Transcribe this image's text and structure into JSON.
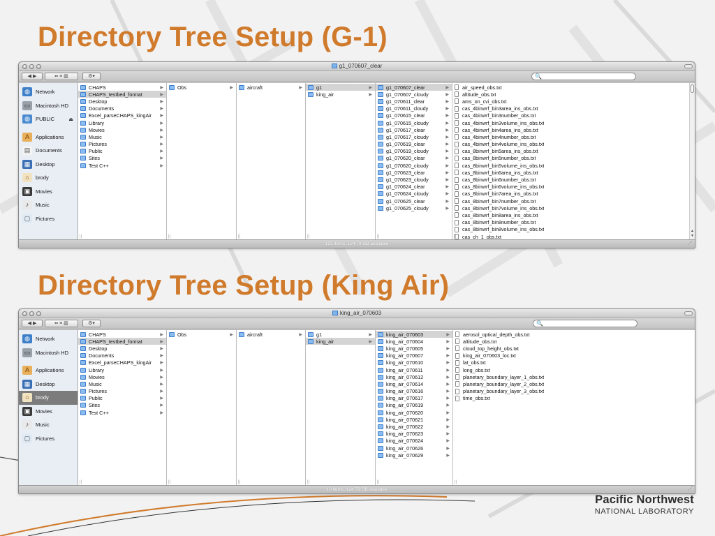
{
  "slide": {
    "title_g1": "Directory Tree Setup (G-1)",
    "title_kingair": "Directory Tree Setup (King Air)",
    "logo_main": "Pacific Northwest",
    "logo_sub": "NATIONAL LABORATORY",
    "accent_color": "#d07a2c"
  },
  "window_g1": {
    "title": "g1_070607_clear",
    "status": "122 items, 124.79 GB available",
    "sidebar": [
      {
        "label": "Network",
        "icon": "globe-icon"
      },
      {
        "label": "Macintosh HD",
        "icon": "hard-drive-icon"
      },
      {
        "label": "PUBLIC",
        "icon": "network-volume-icon",
        "eject": true
      },
      {
        "label": "Applications",
        "icon": "applications-icon"
      },
      {
        "label": "Documents",
        "icon": "documents-icon"
      },
      {
        "label": "Desktop",
        "icon": "desktop-icon"
      },
      {
        "label": "brody",
        "icon": "home-icon"
      },
      {
        "label": "Movies",
        "icon": "movies-icon"
      },
      {
        "label": "Music",
        "icon": "music-icon"
      },
      {
        "label": "Pictures",
        "icon": "pictures-icon"
      }
    ],
    "col1": [
      "CHAPS",
      "CHAPS_testbed_format",
      "Desktop",
      "Documents",
      "Excel_parseCHAPS_kingAir",
      "Library",
      "Movies",
      "Music",
      "Pictures",
      "Public",
      "Sites",
      "Test C++"
    ],
    "col1_selected": 1,
    "col2": [
      "Obs"
    ],
    "col3": [
      "aircraft"
    ],
    "col4": [
      "g1",
      "king_air"
    ],
    "col4_selected": 0,
    "col5": [
      "g1_070607_clear",
      "g1_070607_cloudy",
      "g1_070611_clear",
      "g1_070611_cloudy",
      "g1_070615_clear",
      "g1_070615_cloudy",
      "g1_070617_clear",
      "g1_070617_cloudy",
      "g1_070619_clear",
      "g1_070619_cloudy",
      "g1_070620_clear",
      "g1_070620_cloudy",
      "g1_070623_clear",
      "g1_070623_cloudy",
      "g1_070624_clear",
      "g1_070624_cloudy",
      "g1_070625_clear",
      "g1_070625_cloudy"
    ],
    "col5_selected": 0,
    "files": [
      "air_speed_obs.txt",
      "altitude_obs.txt",
      "ams_on_cvi_obs.txt",
      "cas_4binwrf_bin3area_ins_obs.txt",
      "cas_4binwrf_bin3number_obs.txt",
      "cas_4binwrf_bin3volume_ins_obs.txt",
      "cas_4binwrf_bin4area_ins_obs.txt",
      "cas_4binwrf_bin4number_obs.txt",
      "cas_4binwrf_bin4volume_ins_obs.txt",
      "cas_8binwrf_bin5area_ins_obs.txt",
      "cas_8binwrf_bin5number_obs.txt",
      "cas_8binwrf_bin5volume_ins_obs.txt",
      "cas_8binwrf_bin6area_ins_obs.txt",
      "cas_8binwrf_bin6number_obs.txt",
      "cas_8binwrf_bin6volume_ins_obs.txt",
      "cas_8binwrf_bin7area_ins_obs.txt",
      "cas_8binwrf_bin7number_obs.txt",
      "cas_8binwrf_bin7volume_ins_obs.txt",
      "cas_8binwrf_bin8area_ins_obs.txt",
      "cas_8binwrf_bin8number_obs.txt",
      "cas_8binwrf_bin8volume_ins_obs.txt",
      "cas_ch_1_obs.txt"
    ]
  },
  "window_kingair": {
    "title": "king_air_070603",
    "status": "10 items, 124.79 GB available",
    "sidebar": [
      {
        "label": "Network",
        "icon": "globe-icon"
      },
      {
        "label": "Macintosh HD",
        "icon": "hard-drive-icon"
      },
      {
        "label": "Applications",
        "icon": "applications-icon"
      },
      {
        "label": "Desktop",
        "icon": "desktop-icon"
      },
      {
        "label": "brody",
        "icon": "home-icon",
        "selected": true
      },
      {
        "label": "Movies",
        "icon": "movies-icon"
      },
      {
        "label": "Music",
        "icon": "music-icon"
      },
      {
        "label": "Pictures",
        "icon": "pictures-icon"
      }
    ],
    "col1": [
      "CHAPS",
      "CHAPS_testbed_format",
      "Desktop",
      "Documents",
      "Excel_parseCHAPS_kingAir",
      "Library",
      "Movies",
      "Music",
      "Pictures",
      "Public",
      "Sites",
      "Test C++"
    ],
    "col1_selected": 1,
    "col2": [
      "Obs"
    ],
    "col3": [
      "aircraft"
    ],
    "col4": [
      "g1",
      "king_air"
    ],
    "col4_selected": 1,
    "col5": [
      "king_air_070603",
      "king_air_070604",
      "king_air_070605",
      "king_air_070607",
      "king_air_070610",
      "king_air_070611",
      "king_air_070612",
      "king_air_070614",
      "king_air_070616",
      "king_air_070617",
      "king_air_070619",
      "king_air_070620",
      "king_air_070621",
      "king_air_070622",
      "king_air_070623",
      "king_air_070624",
      "king_air_070626",
      "king_air_070629"
    ],
    "col5_selected": 0,
    "files": [
      "aerosol_optical_depth_obs.txt",
      "altitude_obs.txt",
      "cloud_top_height_obs.txt",
      "king_air_070603_loc.txt",
      "lat_obs.txt",
      "long_obs.txt",
      "planetary_boundary_layer_1_obs.txt",
      "planetary_boundary_layer_2_obs.txt",
      "planetary_boundary_layer_3_obs.txt",
      "time_obs.txt"
    ]
  }
}
